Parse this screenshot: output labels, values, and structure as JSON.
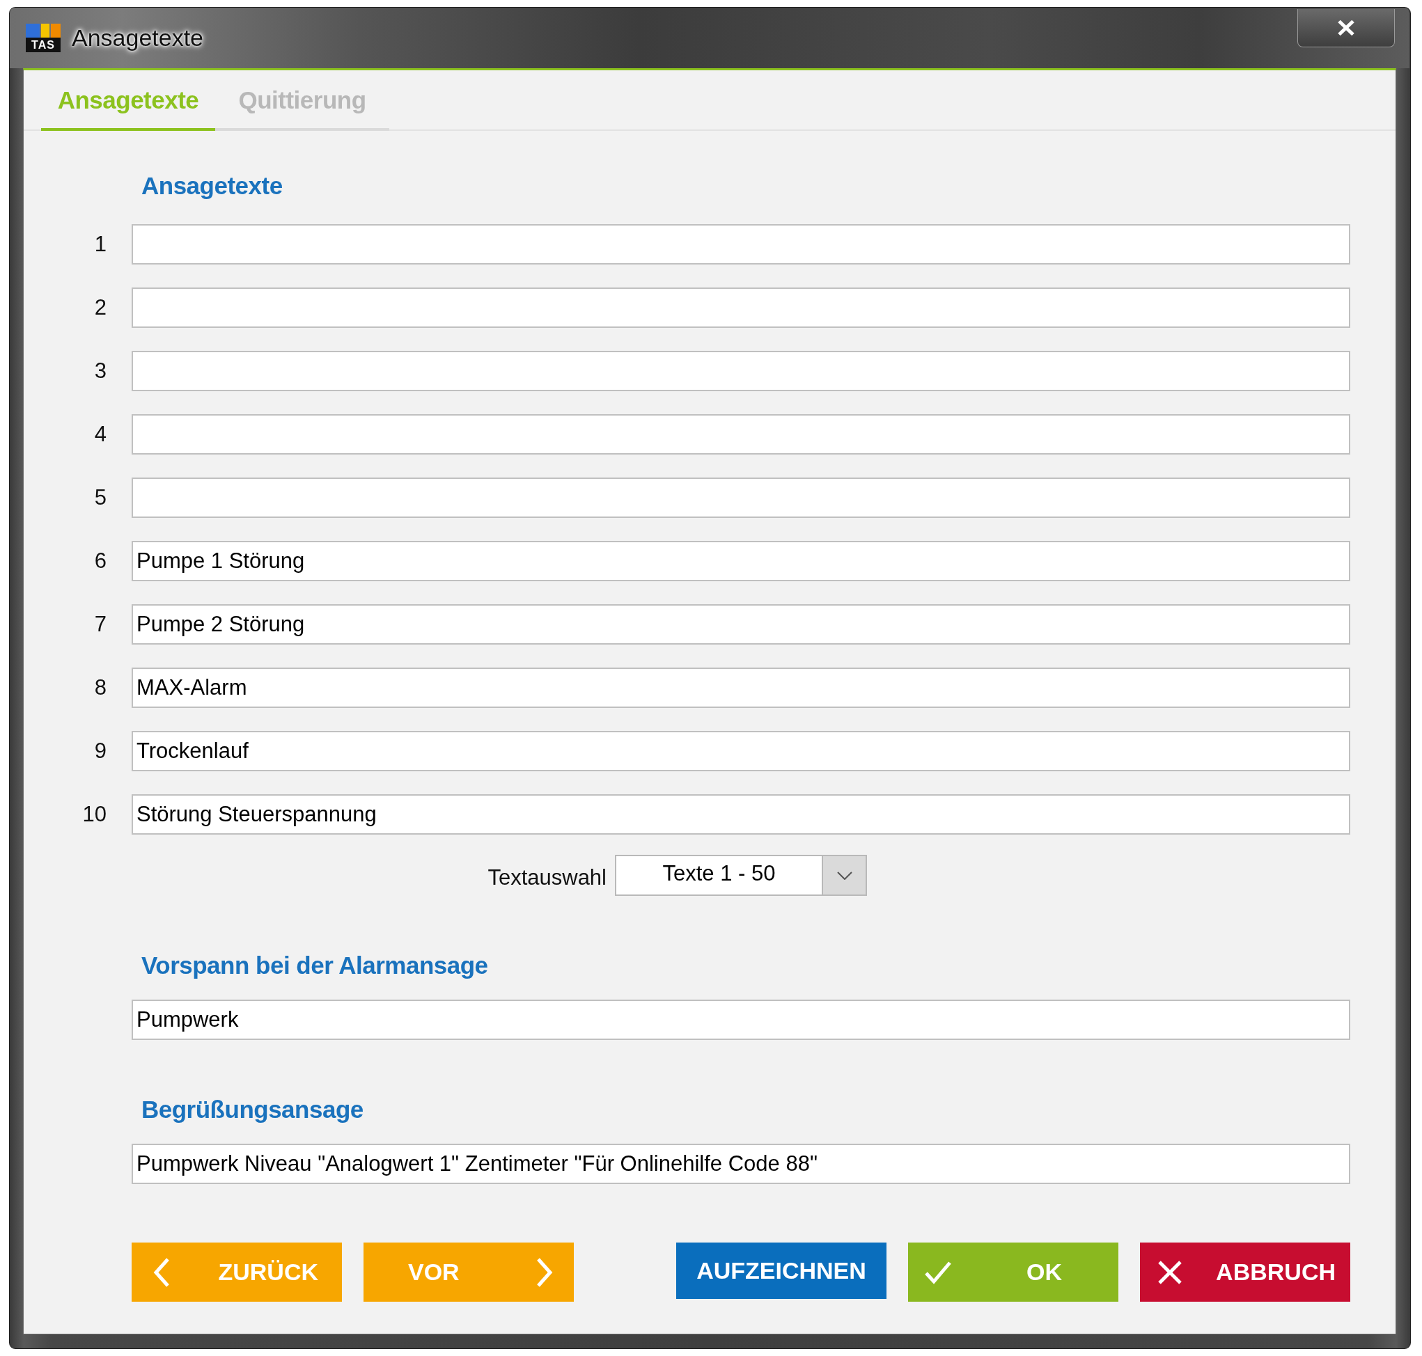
{
  "window": {
    "title": "Ansagetexte",
    "logo_text": "TAS"
  },
  "tabs": [
    {
      "label": "Ansagetexte",
      "selected": true
    },
    {
      "label": "Quittierung",
      "selected": false
    }
  ],
  "announcements": {
    "heading": "Ansagetexte",
    "rows": [
      {
        "number": "1"
      },
      {
        "number": "2"
      },
      {
        "number": "3"
      },
      {
        "number": "4"
      },
      {
        "number": "5"
      },
      {
        "number": "6",
        "value": "Pumpe 1 Störung"
      },
      {
        "number": "7",
        "value": "Pumpe 2 Störung"
      },
      {
        "number": "8",
        "value": "MAX-Alarm"
      },
      {
        "number": "9",
        "value": "Trockenlauf"
      },
      {
        "number": "10",
        "value": "Störung Steuerspannung"
      }
    ]
  },
  "text_selection": {
    "label": "Textauswahl",
    "value": "Texte 1 - 50"
  },
  "prefix": {
    "heading": "Vorspann bei der Alarmansage",
    "value": "Pumpwerk"
  },
  "greeting": {
    "heading": "Begrüßungsansage",
    "value": "Pumpwerk Niveau \"Analogwert 1\" Zentimeter \"Für Onlinehilfe Code 88\""
  },
  "navigation_buttons": [
    {
      "label": "ZURÜCK",
      "kind": "back"
    },
    {
      "label": "VOR",
      "kind": "forward"
    }
  ],
  "action_buttons": [
    {
      "label": "AUFZEICHNEN",
      "kind": "record"
    },
    {
      "label": "OK",
      "kind": "confirm"
    },
    {
      "label": "ABBRUCH",
      "kind": "cancel"
    }
  ]
}
